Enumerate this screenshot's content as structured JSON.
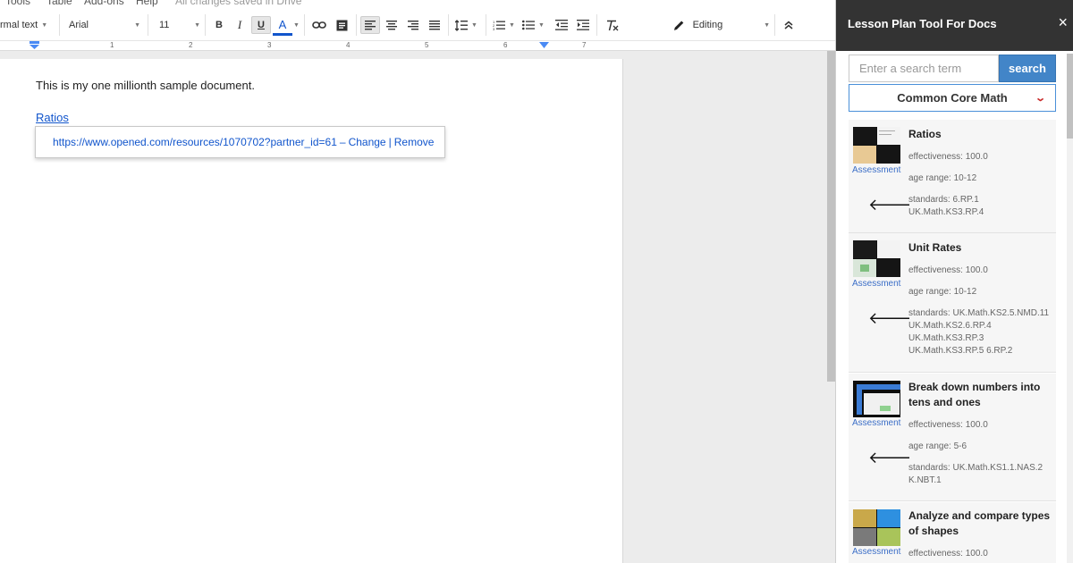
{
  "menu": {
    "items": [
      "Tools",
      "Table",
      "Add-ons",
      "Help"
    ],
    "saved_status": "All changes saved in Drive"
  },
  "toolbar": {
    "style_select": "rmal text",
    "font_select": "Arial",
    "size_select": "11",
    "bold": "B",
    "italic": "I",
    "underline": "U",
    "text_color": "A",
    "mode_label": "Editing"
  },
  "ruler": {
    "ticks": [
      "1",
      "2",
      "3",
      "4",
      "5",
      "6",
      "7"
    ]
  },
  "document": {
    "paragraph": "This is my one millionth sample document.",
    "link_text": "Ratios",
    "link_bubble": {
      "url": "https://www.opened.com/resources/1070702?partner_id=61",
      "dash": "–",
      "change": "Change",
      "pipe": "|",
      "remove": "Remove"
    }
  },
  "sidebar": {
    "title": "Lesson Plan Tool For Docs",
    "close": "×",
    "search_placeholder": "Enter a search term",
    "search_button": "search",
    "subject_select": "Common Core Math",
    "results": [
      {
        "title": "Ratios",
        "type": "Assessment",
        "effectiveness": "effectiveness: 100.0",
        "age_range": "age range: 10-12",
        "standards": [
          "standards: 6.RP.1",
          "UK.Math.KS3.RP.4"
        ]
      },
      {
        "title": "Unit Rates",
        "type": "Assessment",
        "effectiveness": "effectiveness: 100.0",
        "age_range": "age range: 10-12",
        "standards": [
          "standards: UK.Math.KS2.5.NMD.11",
          "UK.Math.KS2.6.RP.4",
          "UK.Math.KS3.RP.3",
          "UK.Math.KS3.RP.5 6.RP.2"
        ]
      },
      {
        "title_lines": [
          "Break down numbers into",
          "tens and ones"
        ],
        "type": "Assessment",
        "effectiveness": "effectiveness: 100.0",
        "age_range": "age range: 5-6",
        "standards": [
          "standards: UK.Math.KS1.1.NAS.2",
          "K.NBT.1"
        ]
      },
      {
        "title_lines": [
          "Analyze and compare types",
          "of shapes"
        ],
        "type": "Assessment",
        "effectiveness": "effectiveness: 100.0"
      }
    ]
  },
  "colors": {
    "accent": "#4285c8",
    "link": "#1155cc",
    "sidebar_header": "#333333",
    "chevron": "#c92a2a"
  }
}
